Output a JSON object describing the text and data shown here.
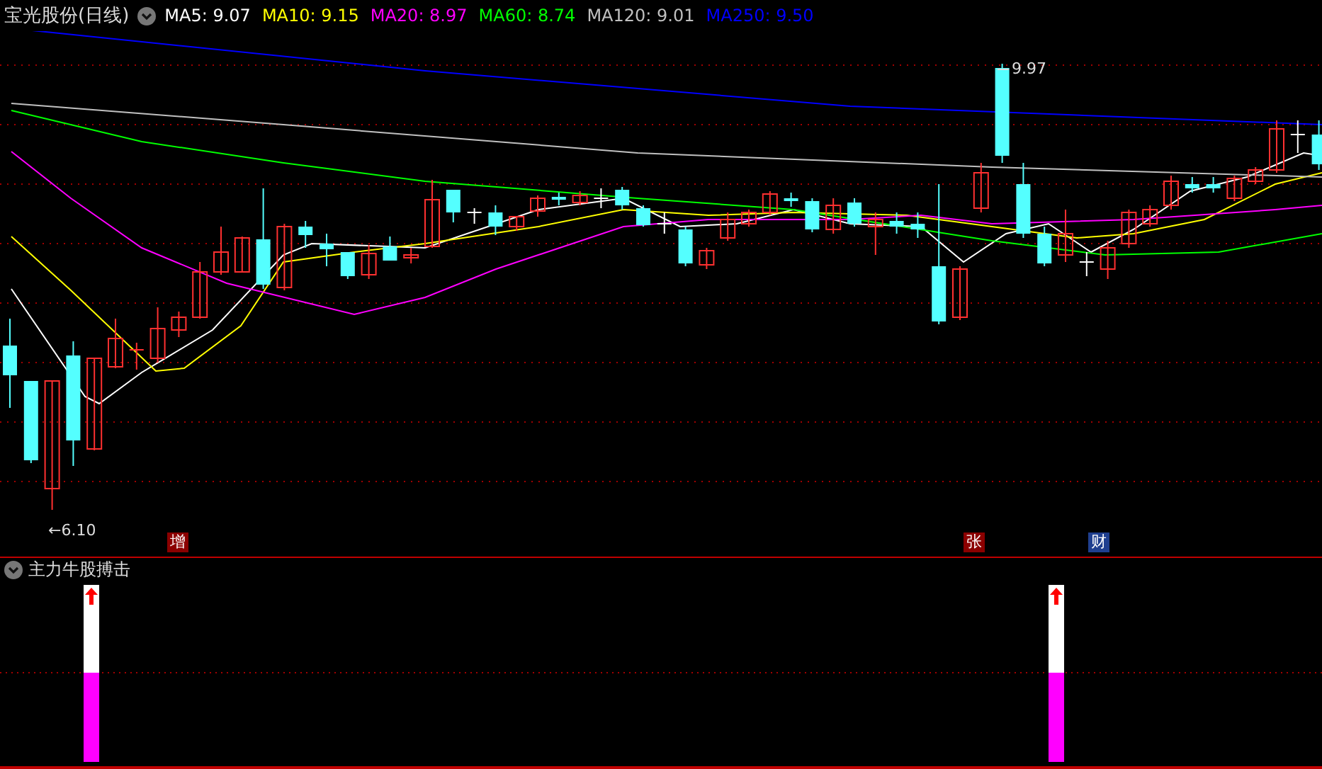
{
  "window": {
    "title": "宝光股份(日线)"
  },
  "ma_legend": [
    {
      "label": "MA5: 9.07",
      "color": "#ffffff"
    },
    {
      "label": "MA10: 9.15",
      "color": "#ffff00"
    },
    {
      "label": "MA20: 8.97",
      "color": "#ff00ff"
    },
    {
      "label": "MA60: 8.74",
      "color": "#00ff00"
    },
    {
      "label": "MA120: 9.01",
      "color": "#c0c0c0"
    },
    {
      "label": "MA250: 9.50",
      "color": "#0000ff"
    }
  ],
  "price_chart": {
    "high_label": "9.97",
    "low_label": "←6.10"
  },
  "event_markers": [
    {
      "text": "增",
      "color": "#8b0000"
    },
    {
      "text": "张",
      "color": "#8b0000"
    },
    {
      "text": "财",
      "color": "#1f3f8f"
    }
  ],
  "indicator": {
    "title": "主力牛股搏击"
  }
}
